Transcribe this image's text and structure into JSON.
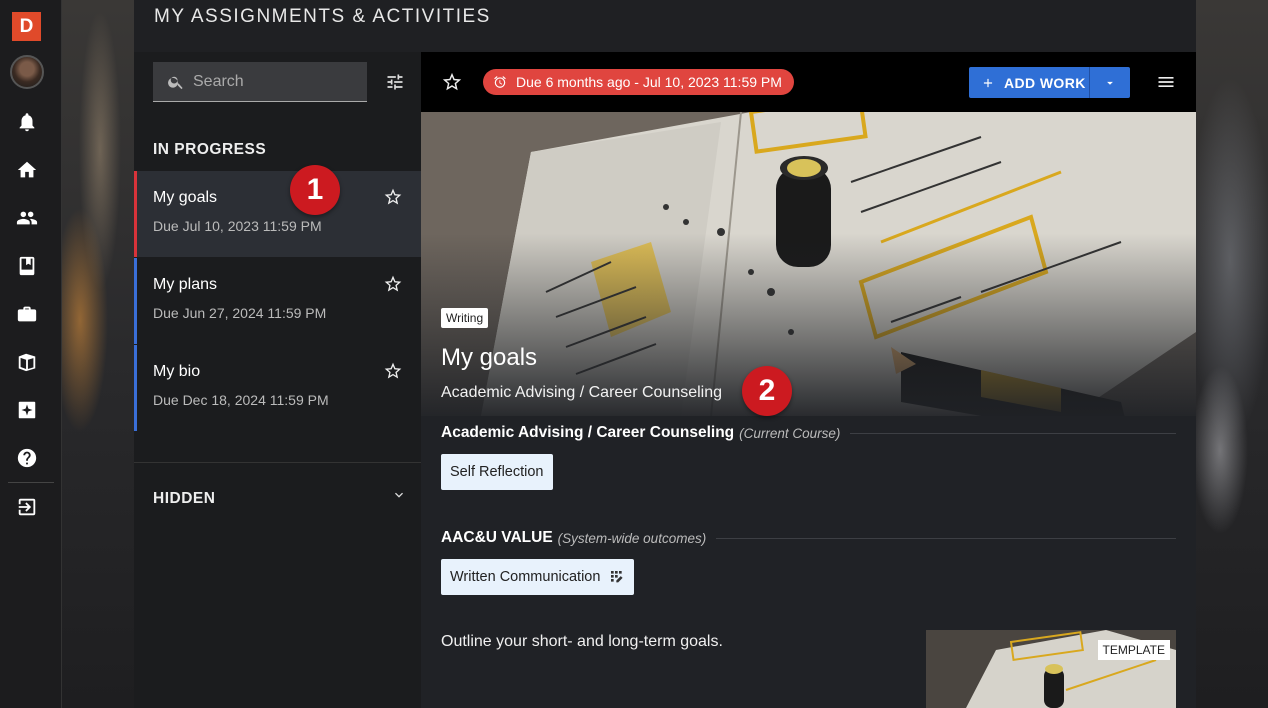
{
  "app": {
    "logo_letter": "D"
  },
  "rail": {
    "items": [
      {
        "name": "bell-icon"
      },
      {
        "name": "home-icon"
      },
      {
        "name": "people-icon"
      },
      {
        "name": "book-icon"
      },
      {
        "name": "briefcase-icon"
      },
      {
        "name": "portfolio-icon"
      },
      {
        "name": "sparkle-icon"
      },
      {
        "name": "help-icon"
      },
      {
        "name": "logout-icon"
      }
    ]
  },
  "header": {
    "title": "MY ASSIGNMENTS & ACTIVITIES"
  },
  "list": {
    "search_placeholder": "Search",
    "in_progress_label": "IN PROGRESS",
    "hidden_label": "HIDDEN",
    "items": [
      {
        "title": "My goals",
        "due": "Due Jul 10, 2023 11:59 PM",
        "active": true
      },
      {
        "title": "My plans",
        "due": "Due Jun 27, 2024 11:59 PM",
        "active": false
      },
      {
        "title": "My bio",
        "due": "Due Dec 18, 2024 11:59 PM",
        "active": false
      }
    ]
  },
  "toolbar": {
    "due_text": "Due 6 months ago - Jul 10, 2023 11:59 PM",
    "add_work_label": "ADD WORK"
  },
  "hero": {
    "tag": "Writing",
    "title": "My goals",
    "subtitle": "Academic Advising / Career Counseling"
  },
  "course_section": {
    "title": "Academic Advising / Career Counseling",
    "note": "(Current Course)",
    "chip": "Self Reflection"
  },
  "outcomes_section": {
    "title": "AAC&U VALUE",
    "note": "(System-wide outcomes)",
    "chip": "Written Communication"
  },
  "description": "Outline your short- and long-term goals.",
  "thumbnail": {
    "label": "TEMPLATE"
  },
  "annotations": [
    "1",
    "2"
  ],
  "colors": {
    "accent_blue": "#2f6fd6",
    "due_red": "#e0453f",
    "active_bar": "#d9333a",
    "logo": "#e04a2a"
  }
}
